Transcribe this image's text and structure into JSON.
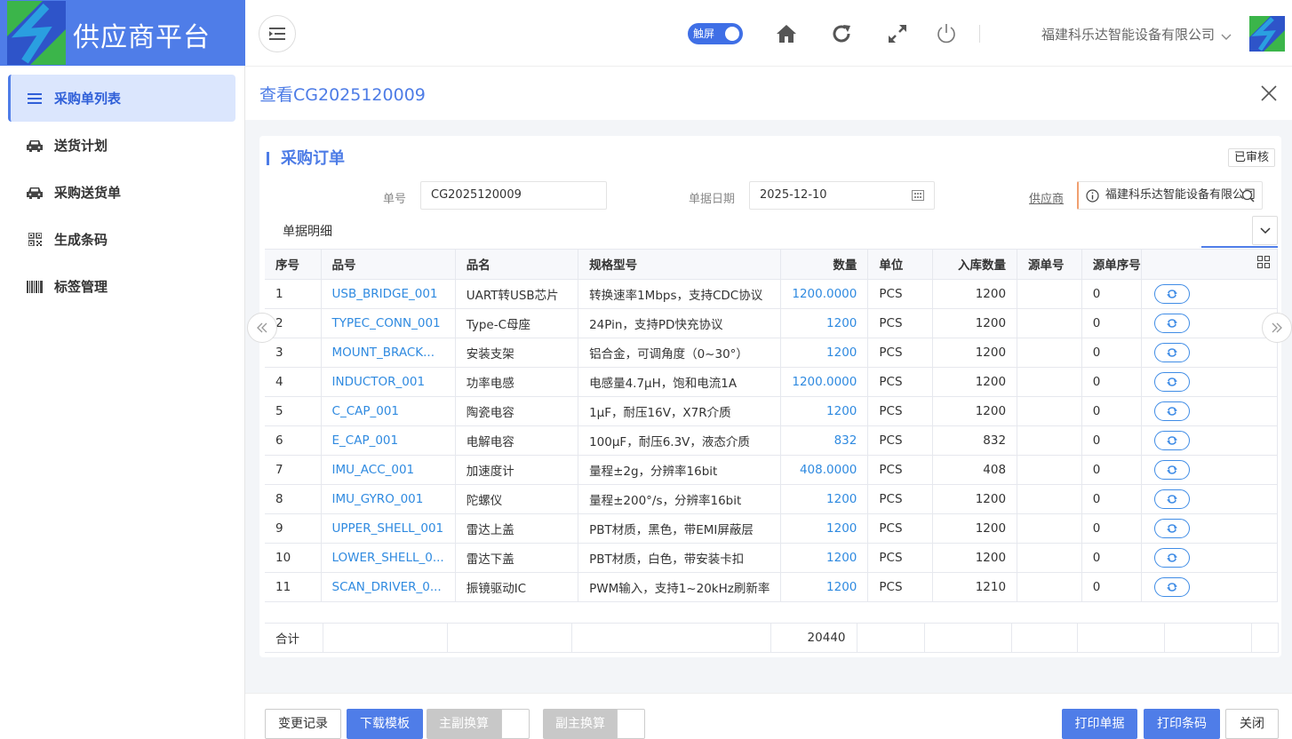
{
  "app": {
    "title": "供应商平台"
  },
  "sidebar": {
    "items": [
      {
        "label": "采购单列表",
        "icon": "list-icon"
      },
      {
        "label": "送货计划",
        "icon": "car-icon"
      },
      {
        "label": "采购送货单",
        "icon": "car-icon"
      },
      {
        "label": "生成条码",
        "icon": "qrcode-icon"
      },
      {
        "label": "标签管理",
        "icon": "barcode-icon"
      }
    ]
  },
  "header": {
    "touch_label": "触屏",
    "touch_on": true,
    "company": "福建科乐达智能设备有限公司"
  },
  "page": {
    "title": "查看CG2025120009"
  },
  "card": {
    "title": "采购订单",
    "status": "已审核",
    "fields": {
      "no_label": "单号",
      "no_value": "CG2025120009",
      "date_label": "单据日期",
      "date_value": "2025-12-10",
      "supplier_label": "供应商",
      "supplier_value": "福建科乐达智能设备有限公司"
    },
    "section_title": "单据明细"
  },
  "table": {
    "columns": [
      "序号",
      "品号",
      "品名",
      "规格型号",
      "数量",
      "单位",
      "入库数量",
      "源单号",
      "源单序号"
    ],
    "rows": [
      [
        "1",
        "USB_BRIDGE_001",
        "UART转USB芯片",
        "转换速率1Mbps，支持CDC协议",
        "1200.0000",
        "PCS",
        "1200",
        "",
        "0"
      ],
      [
        "2",
        "TYPEC_CONN_001",
        "Type-C母座",
        "24Pin，支持PD快充协议",
        "1200",
        "PCS",
        "1200",
        "",
        "0"
      ],
      [
        "3",
        "MOUNT_BRACK...",
        "安装支架",
        "铝合金，可调角度（0~30°）",
        "1200",
        "PCS",
        "1200",
        "",
        "0"
      ],
      [
        "4",
        "INDUCTOR_001",
        "功率电感",
        "电感量4.7μH，饱和电流1A",
        "1200.0000",
        "PCS",
        "1200",
        "",
        "0"
      ],
      [
        "5",
        "C_CAP_001",
        "陶瓷电容",
        "1μF，耐压16V，X7R介质",
        "1200",
        "PCS",
        "1200",
        "",
        "0"
      ],
      [
        "6",
        "E_CAP_001",
        "电解电容",
        "100μF，耐压6.3V，液态介质",
        "832",
        "PCS",
        "832",
        "",
        "0"
      ],
      [
        "7",
        "IMU_ACC_001",
        "加速度计",
        "量程±2g，分辨率16bit",
        "408.0000",
        "PCS",
        "408",
        "",
        "0"
      ],
      [
        "8",
        "IMU_GYRO_001",
        "陀螺仪",
        "量程±200°/s，分辨率16bit",
        "1200",
        "PCS",
        "1200",
        "",
        "0"
      ],
      [
        "9",
        "UPPER_SHELL_001",
        "雷达上盖",
        "PBT材质，黑色，带EMI屏蔽层",
        "1200",
        "PCS",
        "1200",
        "",
        "0"
      ],
      [
        "10",
        "LOWER_SHELL_0...",
        "雷达下盖",
        "PBT材质，白色，带安装卡扣",
        "1200",
        "PCS",
        "1200",
        "",
        "0"
      ],
      [
        "11",
        "SCAN_DRIVER_0...",
        "振镜驱动IC",
        "PWM输入，支持1~20kHz刷新率",
        "1200",
        "PCS",
        "1210",
        "",
        "0"
      ]
    ],
    "total_label": "合计",
    "total_qty": "20440"
  },
  "footer": {
    "change_log": "变更记录",
    "download_template": "下载模板",
    "main_sub_convert": "主副换算",
    "sub_main_convert": "副主换算",
    "print_doc": "打印单据",
    "print_barcode": "打印条码",
    "close": "关闭"
  },
  "colors": {
    "brand": "#4f7de8",
    "link": "#2f8ae0",
    "active_bg": "#dbe6fd"
  }
}
